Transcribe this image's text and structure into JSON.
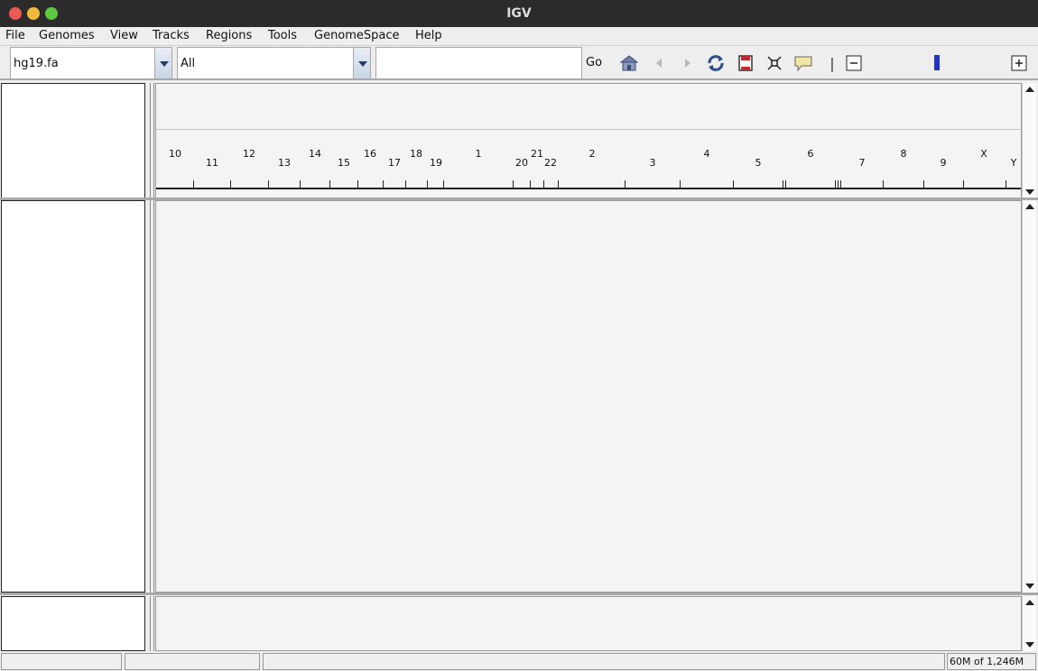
{
  "window": {
    "title": "IGV"
  },
  "menu": [
    "File",
    "Genomes",
    "View",
    "Tracks",
    "Regions",
    "Tools",
    "GenomeSpace",
    "Help"
  ],
  "toolbar": {
    "genome": "hg19.fa",
    "chromosome": "All",
    "locus": "",
    "go_label": "Go",
    "icons": [
      "home-icon",
      "back-arrow-icon",
      "forward-arrow-icon",
      "refresh-icon",
      "region-of-interest-icon",
      "resize-to-window-icon",
      "popup-info-icon",
      "zoom-out-icon",
      "zoom-level-indicator",
      "zoom-in-icon"
    ],
    "zoom_out_label": "−",
    "zoom_in_label": "+",
    "separator_label": "|"
  },
  "ruler": {
    "chromosomes": [
      "10",
      "11",
      "12",
      "13",
      "14",
      "15",
      "16",
      "17",
      "18",
      "19",
      "1",
      "20",
      "21",
      "22",
      "2",
      "3",
      "4",
      "5",
      "6",
      "7",
      "8",
      "9",
      "X",
      "Y"
    ]
  },
  "status": {
    "memory": "60M of 1,246M"
  },
  "colors": {
    "zoom_indicator": "#2233cc",
    "titlebar": "#2b2b2b"
  }
}
